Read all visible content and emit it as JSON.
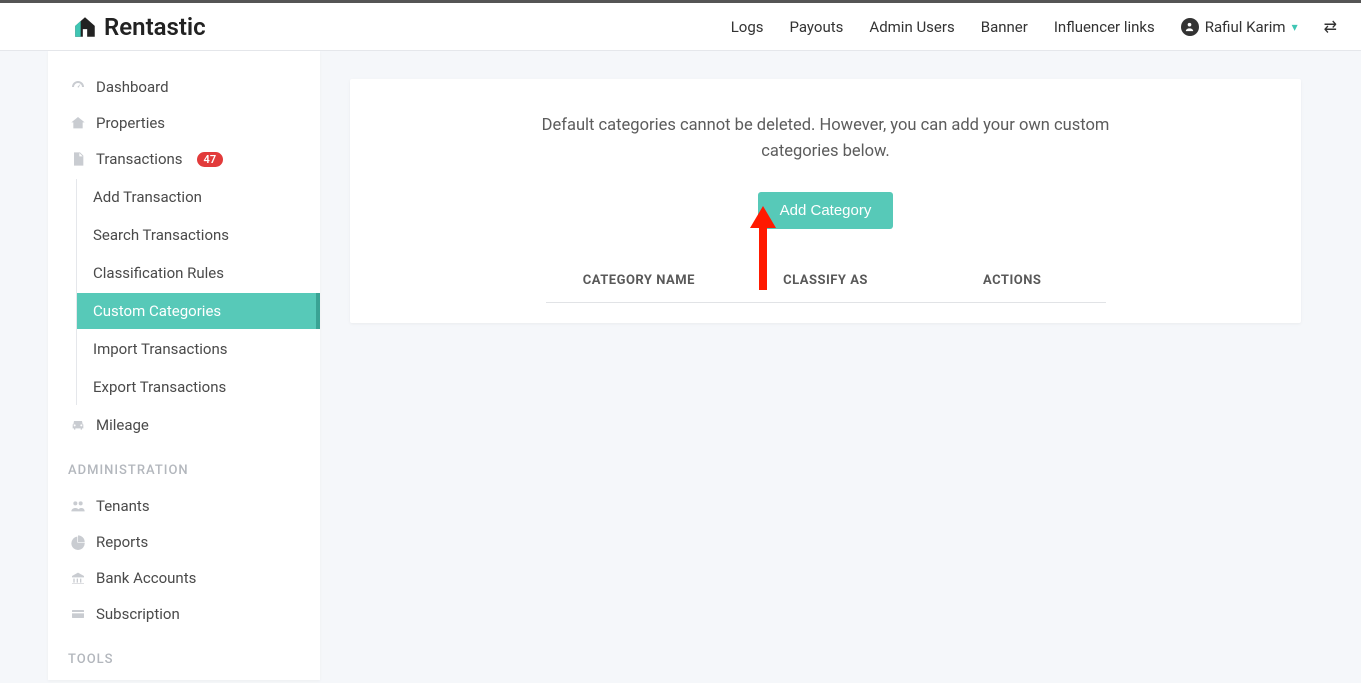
{
  "brand": "Rentastic",
  "topnav": {
    "logs": "Logs",
    "payouts": "Payouts",
    "admin_users": "Admin Users",
    "banner": "Banner",
    "influencer_links": "Influencer links"
  },
  "user": {
    "name": "Rafiul Karim"
  },
  "sidebar": {
    "dashboard": "Dashboard",
    "properties": "Properties",
    "transactions": "Transactions",
    "transactions_badge": "47",
    "sub": {
      "add_transaction": "Add Transaction",
      "search_transactions": "Search Transactions",
      "classification_rules": "Classification Rules",
      "custom_categories": "Custom Categories",
      "import_transactions": "Import Transactions",
      "export_transactions": "Export Transactions"
    },
    "mileage": "Mileage",
    "section_admin": "ADMINISTRATION",
    "tenants": "Tenants",
    "reports": "Reports",
    "bank_accounts": "Bank Accounts",
    "subscription": "Subscription",
    "section_tools": "TOOLS"
  },
  "main": {
    "info": "Default categories cannot be deleted. However, you can add your own custom categories below.",
    "add_btn": "Add Category",
    "col_name": "CATEGORY NAME",
    "col_classify": "CLASSIFY AS",
    "col_actions": "ACTIONS"
  }
}
